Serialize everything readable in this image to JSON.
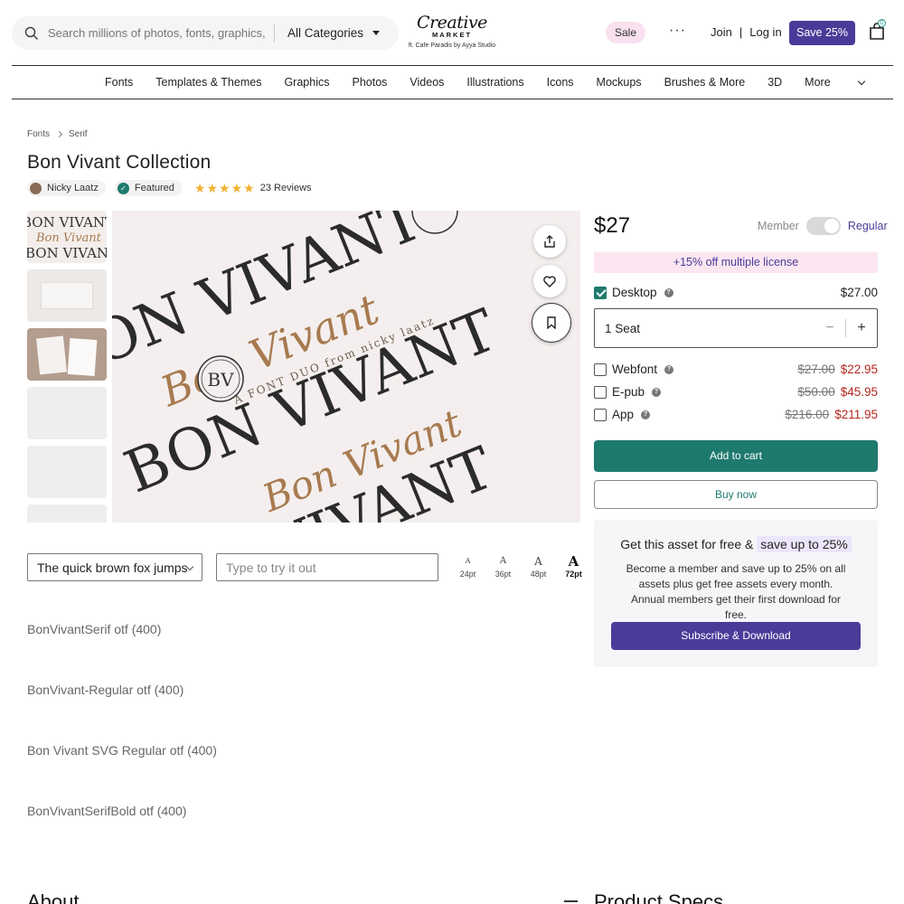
{
  "header": {
    "search_placeholder": "Search millions of photos, fonts, graphics, an...",
    "category": "All Categories",
    "logo_line1": "Creative",
    "logo_line2": "MARKET",
    "logo_tagline": "ft. Cafe Paradis by Ayya Studio",
    "sale": "Sale",
    "more_dots": "···",
    "join": "Join",
    "separator": "|",
    "login": "Log in",
    "save_button": "Save 25%",
    "cart_count": "0"
  },
  "nav": {
    "items": [
      "Fonts",
      "Templates & Themes",
      "Graphics",
      "Photos",
      "Videos",
      "Illustrations",
      "Icons",
      "Mockups",
      "Brushes & More",
      "3D"
    ],
    "more": "More"
  },
  "breadcrumb": [
    "Fonts",
    "Serif"
  ],
  "product": {
    "title": "Bon Vivant Collection",
    "author": "Nicky Laatz",
    "featured": "Featured",
    "rating": 5,
    "reviews": "23 Reviews"
  },
  "preview": {
    "banner_big": [
      "BON VIVANT",
      "BON VIVANT",
      "BON VIVANT"
    ],
    "script": "Bon Vivant",
    "subtitle": "A FONT DUO from nicky laatz",
    "monogram": "BV"
  },
  "tester": {
    "sample_text": "The quick brown fox jumps",
    "try_placeholder": "Type to try it out",
    "sizes": [
      {
        "label": "24pt",
        "glyph": "A"
      },
      {
        "label": "36pt",
        "glyph": "A"
      },
      {
        "label": "48pt",
        "glyph": "A"
      },
      {
        "label": "72pt",
        "glyph": "A"
      }
    ],
    "active_size": "72pt"
  },
  "font_styles": [
    "BonVivantSerif otf (400)",
    "BonVivant-Regular otf (400)",
    "Bon Vivant SVG Regular otf (400)",
    "BonVivantSerifBold otf (400)"
  ],
  "sections": {
    "about": "About",
    "specs": "Product Specs"
  },
  "purchase": {
    "price": "$27",
    "license_member": "Member",
    "license_regular": "Regular",
    "promo_bold": "+15% off",
    "promo_text": "multiple license",
    "desktop": {
      "label": "Desktop",
      "price": "$27.00",
      "checked": true
    },
    "seat": "1 Seat",
    "options": [
      {
        "label": "Webfont",
        "old": "$27.00",
        "new": "$22.95"
      },
      {
        "label": "E-pub",
        "old": "$50.00",
        "new": "$45.95"
      },
      {
        "label": "App",
        "old": "$216.00",
        "new": "$211.95"
      }
    ],
    "add_to_cart": "Add to cart",
    "buy_now": "Buy now"
  },
  "membership": {
    "title_prefix": "Get this asset for free &",
    "title_highlight": "save up to 25%",
    "body": "Become a member and save up to 25% on all assets plus get free assets every month. Annual members get their first download for free.",
    "button": "Subscribe & Download"
  },
  "colors": {
    "accent_teal": "#1f7a6e",
    "accent_purple": "#4b3b99",
    "sale_red": "#b3261e",
    "promo_pink": "#fbe6f1",
    "gold_star": "#f2b233"
  }
}
